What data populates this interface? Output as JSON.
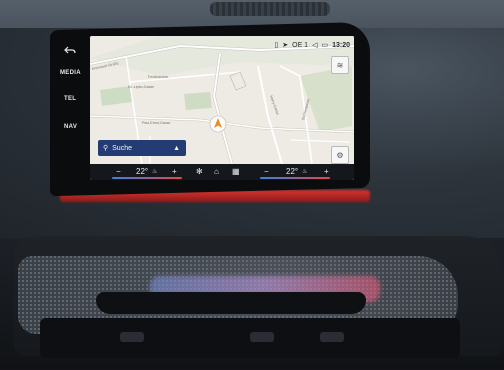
{
  "side_menu": {
    "items": [
      {
        "label": "MEDIA"
      },
      {
        "label": "TEL"
      },
      {
        "label": "NAV"
      }
    ]
  },
  "status_bar": {
    "radio": "OE 1",
    "time": "13:20"
  },
  "search": {
    "label": "Suche"
  },
  "map": {
    "streets": [
      "Kronstadt-Straße",
      "Ferdinandstr.",
      "Dr.-Lipán-Gasse",
      "Paul-Ernst-Gasse",
      "Harry-Gasse",
      "Buchengasse"
    ]
  },
  "climate": {
    "left_temp": "22°",
    "right_temp": "22°",
    "minus": "−",
    "plus": "+"
  }
}
